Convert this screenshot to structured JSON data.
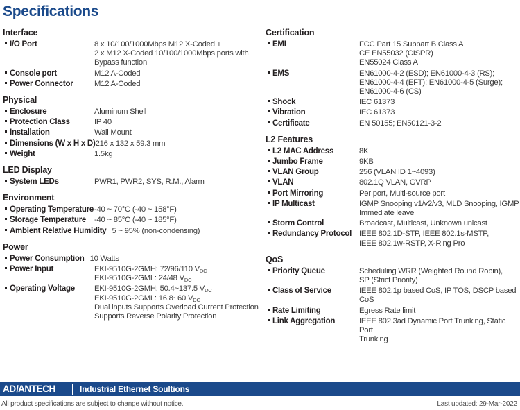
{
  "title": "Specifications",
  "left_column": [
    {
      "section": "Interface",
      "rows": [
        {
          "label": "I/O Port",
          "values": [
            "8 x 10/100/1000Mbps M12 X-Coded +",
            "2 x M12 X-Coded 10/100/1000Mbps ports with",
            "Bypass function"
          ]
        },
        {
          "label": "Console port",
          "values": [
            "M12 A-Coded"
          ]
        },
        {
          "label": "Power Connector",
          "values": [
            "M12 A-Coded"
          ]
        }
      ]
    },
    {
      "section": "Physical",
      "rows": [
        {
          "label": "Enclosure",
          "values": [
            "Aluminum Shell"
          ]
        },
        {
          "label": "Protection Class",
          "values": [
            "IP 40"
          ]
        },
        {
          "label": "Installation",
          "values": [
            "Wall Mount"
          ]
        },
        {
          "label": "Dimensions (W x H x D)",
          "values": [
            "216 x 132 x 59.3 mm"
          ]
        },
        {
          "label": "Weight",
          "values": [
            "1.5kg"
          ]
        }
      ]
    },
    {
      "section": "LED Display",
      "rows": [
        {
          "label": "System LEDs",
          "values": [
            "PWR1, PWR2, SYS, R.M., Alarm"
          ]
        }
      ]
    },
    {
      "section": "Environment",
      "rows": [
        {
          "label": "Operating Temperature",
          "values": [
            "-40 ~ 70°C (-40 ~ 158°F)"
          ]
        },
        {
          "label": "Storage Temperature",
          "values": [
            "-40 ~ 85°C (-40 ~ 185°F)"
          ]
        },
        {
          "label": "Ambient Relative Humidity",
          "wide": true,
          "values": [
            "5 ~ 95% (non-condensing)"
          ]
        }
      ]
    },
    {
      "section": "Power",
      "rows": [
        {
          "label": "Power Consumption",
          "wide": true,
          "values": [
            "10 Watts"
          ]
        },
        {
          "label": "Power Input",
          "values": [
            "EKI-9510G-2GMH: 72/96/110 V|DC",
            "EKI-9510G-2GML: 24/48 V|DC"
          ]
        },
        {
          "label": "Operating Voltage",
          "values": [
            "EKI-9510G-2GMH: 50.4~137.5 V|DC",
            "EKI-9510G-2GML: 16.8~60 V|DC",
            "Dual inputs Supports Overload Current Protection",
            "Supports Reverse Polarity Protection"
          ]
        }
      ]
    }
  ],
  "right_column": [
    {
      "section": "Certification",
      "rows": [
        {
          "label": "EMI",
          "values": [
            "FCC Part 15 Subpart B Class A",
            "CE EN55032 (CISPR)",
            "EN55024 Class A"
          ]
        },
        {
          "label": "EMS",
          "values": [
            "EN61000-4-2 (ESD); EN61000-4-3 (RS);",
            "EN61000-4-4 (EFT); EN61000-4-5 (Surge);",
            "EN61000-4-6 (CS)"
          ]
        },
        {
          "label": "Shock",
          "values": [
            "IEC 61373"
          ]
        },
        {
          "label": "Vibration",
          "values": [
            "IEC 61373"
          ]
        },
        {
          "label": "Certificate",
          "values": [
            "EN 50155; EN50121-3-2"
          ]
        }
      ]
    },
    {
      "section": "L2 Features",
      "rows": [
        {
          "label": "L2 MAC Address",
          "values": [
            "8K"
          ]
        },
        {
          "label": "Jumbo Frame",
          "values": [
            "9KB"
          ]
        },
        {
          "label": "VLAN Group",
          "values": [
            "256 (VLAN ID 1~4093)"
          ]
        },
        {
          "label": "VLAN",
          "values": [
            "802.1Q VLAN, GVRP"
          ]
        },
        {
          "label": "Port Mirroring",
          "values": [
            "Per port, Multi-source port"
          ]
        },
        {
          "label": "IP Multicast",
          "values": [
            "IGMP Snooping v1/v2/v3, MLD Snooping, IGMP",
            "Immediate leave"
          ]
        },
        {
          "label": "Storm Control",
          "values": [
            "Broadcast, Multicast, Unknown unicast"
          ]
        },
        {
          "label": "Redundancy Protocol",
          "values": [
            "IEEE 802.1D-STP, IEEE 802.1s-MSTP,",
            "IEEE 802.1w-RSTP, X-Ring Pro"
          ]
        }
      ]
    },
    {
      "section": "QoS",
      "rows": [
        {
          "label": "Priority Queue",
          "values": [
            "Scheduling WRR (Weighted Round Robin),",
            "SP (Strict Priority)"
          ]
        },
        {
          "label": "Class of Service",
          "values": [
            "IEEE 802.1p based CoS, IP TOS, DSCP based CoS"
          ]
        },
        {
          "label": "Rate Limiting",
          "values": [
            "Egress Rate limit"
          ]
        },
        {
          "label": "Link Aggregation",
          "values": [
            "IEEE 802.3ad Dynamic Port Trunking, Static Port",
            "Trunking"
          ]
        }
      ]
    }
  ],
  "footer": {
    "logo_pre": "AD",
    "logo_slash": "\\",
    "logo_post": "ANTECH",
    "tagline": "Industrial Ethernet Soultions",
    "disclaimer": "All product specifications are subject to change without notice.",
    "last_updated": "Last updated: 29-Mar-2022"
  },
  "colors": {
    "brand_blue": "#1b4a8b",
    "text": "#231f20",
    "value_text": "#3b3b3b"
  }
}
